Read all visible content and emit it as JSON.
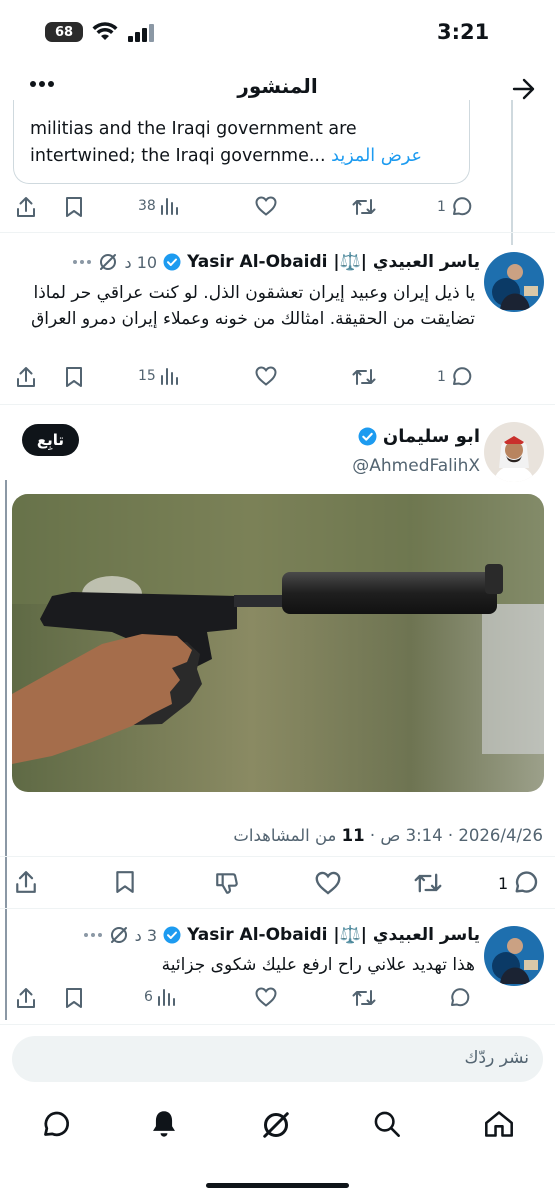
{
  "status_bar": {
    "time": "3:21",
    "battery": "68"
  },
  "header": {
    "title": "المنشور"
  },
  "quoted_card": {
    "line1": "militias and the Iraqi government are",
    "line2": "intertwined; the Iraqi governme...",
    "more_link": "عرض المزيد"
  },
  "top_actions": {
    "views": "38",
    "replies": "1"
  },
  "reply1": {
    "name": "ياسر العبيدي |⚖️| Yasir Al-Obaidi",
    "time": "10 د",
    "text": "يا ذيل إيران وعبيد إيران تعشقون الذل. لو كنت عراقي حر لماذا تضايقت من الحقيقة. امثالك من خونه وعملاء إيران دمرو العراق",
    "views": "15",
    "replies": "1"
  },
  "main_post": {
    "name": "ابو سليمان",
    "handle": "@AhmedFalihX",
    "follow_label": "تابِع",
    "date": "2026/4/26",
    "time": "3:14 ص",
    "views_count": "11",
    "views_label": "من المشاهدات",
    "replies": "1"
  },
  "reply2": {
    "name": "ياسر العبيدي |⚖️| Yasir Al-Obaidi",
    "time": "3 د",
    "text": "هذا تهديد علاني راح ارفع عليك شكوى جزائية",
    "views": "6"
  },
  "composer": {
    "placeholder": "نشر ردّك"
  },
  "colors": {
    "accent": "#1d9bf0",
    "text": "#0f1419",
    "muted": "#536471",
    "border": "#eff3f4"
  },
  "icons": [
    "back-arrow-icon",
    "more-icon",
    "share-icon",
    "bookmark-icon",
    "views-icon",
    "like-icon",
    "repost-icon",
    "reply-icon",
    "verified-icon",
    "grok-icon",
    "dislike-icon",
    "home-icon",
    "search-icon",
    "notifications-icon",
    "messages-icon"
  ]
}
